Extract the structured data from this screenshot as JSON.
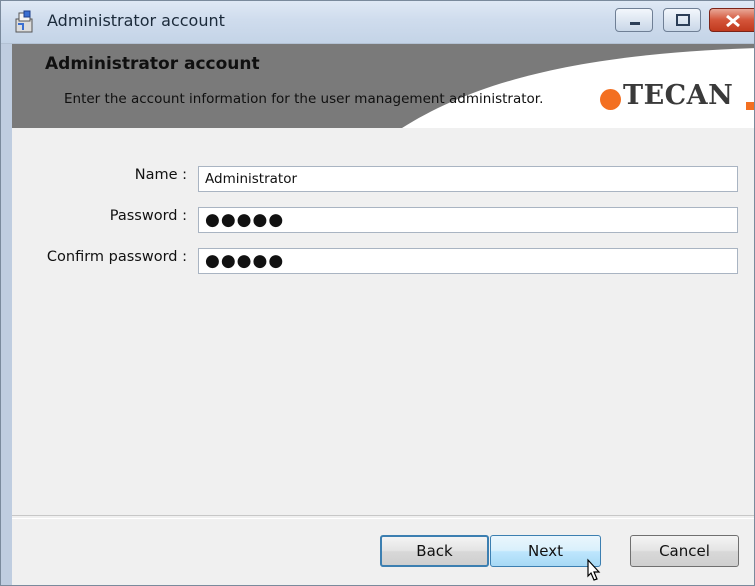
{
  "window": {
    "title": "Administrator account",
    "icon": "installer-icon"
  },
  "title_controls": {
    "minimize": "minimize-icon",
    "maximize": "maximize-icon",
    "close": "close-icon"
  },
  "header": {
    "title": "Administrator account",
    "description": "Enter the account information for the user management administrator.",
    "logo_text": "TECAN"
  },
  "form": {
    "name_label": "Name :",
    "name_value": "Administrator",
    "password_label": "Password :",
    "password_value": "●●●●●",
    "confirm_label": "Confirm password :",
    "confirm_value": "●●●●●"
  },
  "buttons": {
    "back": "Back",
    "next": "Next",
    "cancel": "Cancel"
  },
  "colors": {
    "brand_orange": "#f36f21",
    "header_gray": "#7a7a7a",
    "focus_blue": "#3c7fb1"
  }
}
